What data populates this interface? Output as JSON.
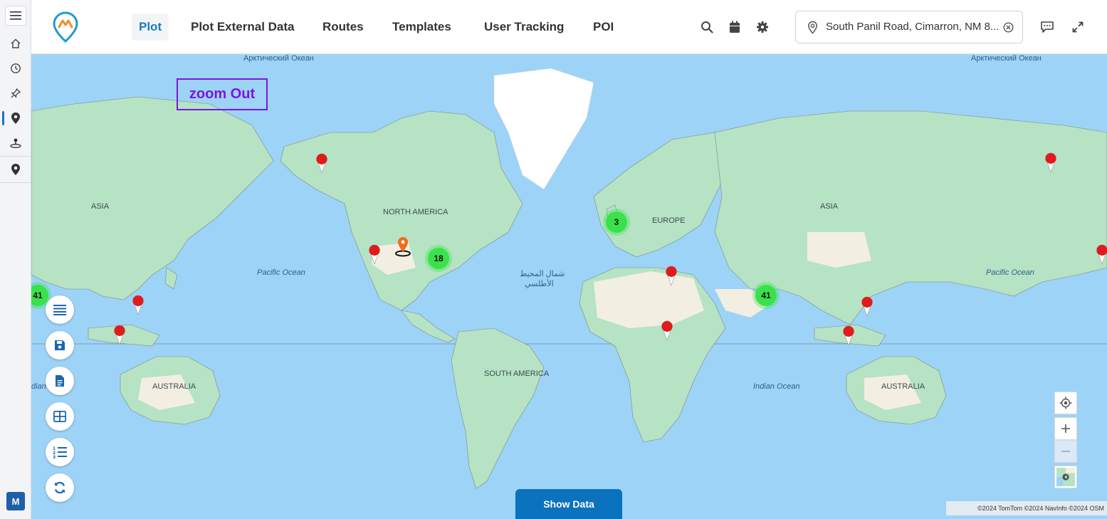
{
  "header": {
    "tabs": [
      {
        "label": "Plot",
        "active": true
      },
      {
        "label": "Plot External Data",
        "active": false
      },
      {
        "label": "Routes",
        "active": false
      },
      {
        "label": "Templates",
        "active": false
      },
      {
        "label": "User Tracking",
        "active": false
      },
      {
        "label": "POI",
        "active": false
      }
    ],
    "location": "South Panil Road, Cimarron, NM 8...",
    "icons": [
      "search-icon",
      "calendar-icon",
      "gear-icon",
      "map-pin-icon",
      "clear-icon",
      "chat-icon",
      "expand-icon"
    ]
  },
  "sidebar": {
    "items": [
      "home-icon",
      "history-icon",
      "pin-icon",
      "location-icon",
      "tracking-icon",
      "poi-icon"
    ],
    "active_item": "location-icon",
    "user_initial": "M"
  },
  "map": {
    "annotation": "zoom Out",
    "labels": {
      "asia_left": "ASIA",
      "asia_right": "ASIA",
      "north_america": "NORTH AMERICA",
      "south_america": "SOUTH AMERICA",
      "europe": "EUROPE",
      "australia_left": "AUSTRALIA",
      "australia_right": "AUSTRALIA",
      "arctic_left": "Арктический Океан",
      "arctic_right": "Арктический Океан",
      "pacific_left": "Pacific Ocean",
      "pacific_right": "Pacific Ocean",
      "atlantic_line1": "شمال المحيط",
      "atlantic_line2": "الأطلسي",
      "indian": "Indian Ocean",
      "indian_left_edge": "dian"
    },
    "clusters": [
      {
        "name": "cluster-north-america",
        "count": "18"
      },
      {
        "name": "cluster-europe",
        "count": "3"
      },
      {
        "name": "cluster-india",
        "count": "41"
      },
      {
        "name": "cluster-india-wrap",
        "count": "41"
      }
    ],
    "show_data_label": "Show Data",
    "attribution": "©2024 TomTom ©2024 NavInfo ©2024 OSM",
    "colors": {
      "water": "#9dd3f7",
      "land": "#b5e3c4",
      "desert": "#f3eee2",
      "cluster": "#39e24a",
      "pin": "#e01b1b",
      "accent": "#1a7bbf"
    }
  }
}
